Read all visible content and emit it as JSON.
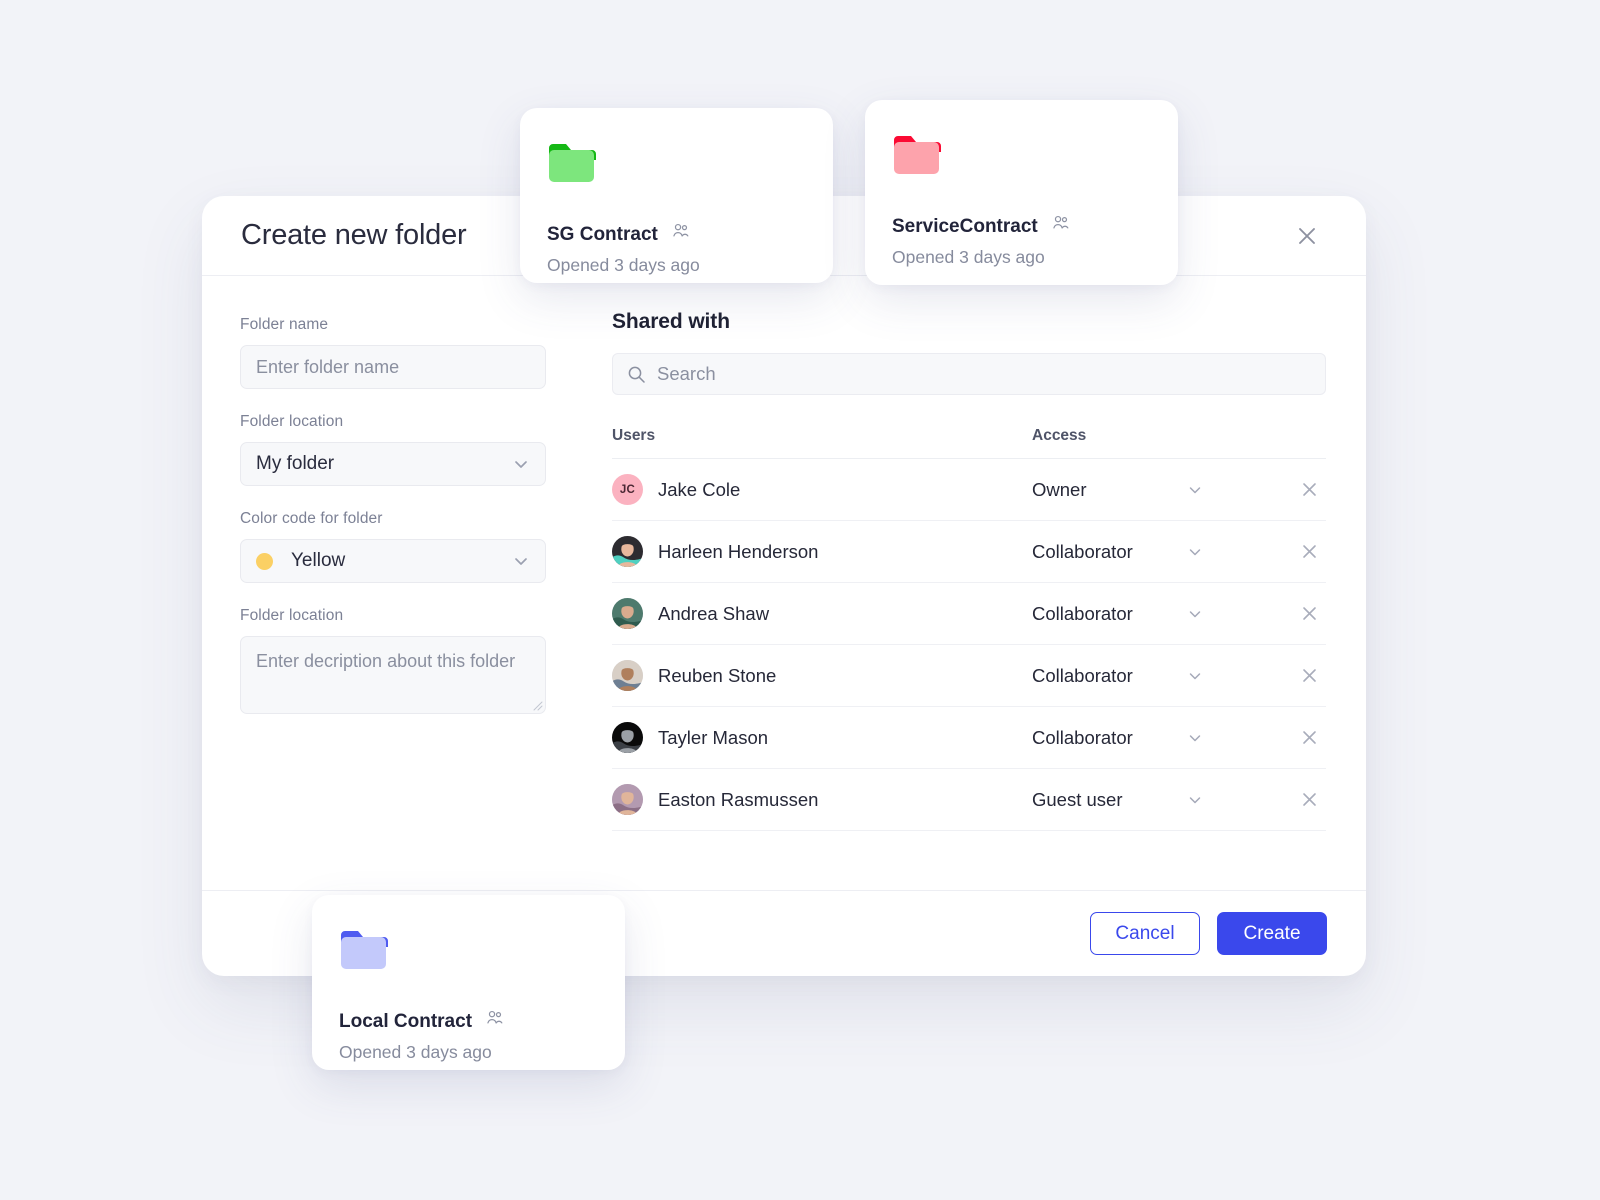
{
  "theme": {
    "background": "#f2f3f8",
    "accent": "#3a48ec",
    "surface": "#ffffff",
    "muted_text": "#7c8195",
    "body_text": "#262838"
  },
  "modal": {
    "title": "Create new folder",
    "close_icon": "close-icon",
    "form": {
      "name_field": {
        "label": "Folder name",
        "placeholder": "Enter folder name",
        "value": ""
      },
      "location_field": {
        "label": "Folder location",
        "value": "My folder",
        "chevron_icon": "chevron-down-icon"
      },
      "color_field": {
        "label": "Color code for folder",
        "value": "Yellow",
        "swatch": "#fbd064",
        "chevron_icon": "chevron-down-icon"
      },
      "description_field": {
        "label": "Folder location",
        "placeholder": "Enter decription about this folder",
        "value": ""
      }
    },
    "shared": {
      "title": "Shared with",
      "search": {
        "placeholder": "Search",
        "value": "",
        "icon": "search-icon"
      },
      "columns": {
        "users": "Users",
        "access": "Access"
      },
      "rows": [
        {
          "name": "Jake Cole",
          "access": "Owner",
          "avatar_type": "initials",
          "initials": "JC",
          "avatar_bg": "#fbb2c0",
          "avatar_fg": "#4a2733",
          "chevron_icon": "chevron-down-icon",
          "remove_icon": "close-icon"
        },
        {
          "name": "Harleen Henderson",
          "access": "Collaborator",
          "avatar_type": "photo",
          "avatar_bg": "#2d2b30",
          "avatar_fg": "#e8b79c",
          "avatar_accent": "#4fd0c0",
          "chevron_icon": "chevron-down-icon",
          "remove_icon": "close-icon"
        },
        {
          "name": "Andrea Shaw",
          "access": "Collaborator",
          "avatar_type": "photo",
          "avatar_bg": "#4e7a6d",
          "avatar_fg": "#d9ab8e",
          "avatar_accent": "#2f5b4e",
          "chevron_icon": "chevron-down-icon",
          "remove_icon": "close-icon"
        },
        {
          "name": "Reuben Stone",
          "access": "Collaborator",
          "avatar_type": "photo",
          "avatar_bg": "#d8cfc6",
          "avatar_fg": "#b07f5c",
          "avatar_accent": "#6e7f93",
          "chevron_icon": "chevron-down-icon",
          "remove_icon": "close-icon"
        },
        {
          "name": "Tayler Mason",
          "access": "Collaborator",
          "avatar_type": "photo",
          "avatar_bg": "#0a0a0a",
          "avatar_fg": "#9ba0a6",
          "avatar_accent": "#3b3f45",
          "chevron_icon": "chevron-down-icon",
          "remove_icon": "close-icon"
        },
        {
          "name": "Easton Rasmussen",
          "access": "Guest user",
          "avatar_type": "photo",
          "avatar_bg": "#b39ab0",
          "avatar_fg": "#e0b59a",
          "avatar_accent": "#8c6f86",
          "chevron_icon": "chevron-down-icon",
          "remove_icon": "close-icon"
        }
      ]
    },
    "footer": {
      "cancel_label": "Cancel",
      "create_label": "Create"
    }
  },
  "folder_cards": [
    {
      "name": "SG Contract",
      "subtitle": "Opened 3 days ago",
      "folder_icon": "folder-icon",
      "shared_icon": "users-icon",
      "tab_color": "#15b815",
      "body_color": "#7de67d"
    },
    {
      "name": "ServiceContract",
      "subtitle": "Opened 3 days ago",
      "folder_icon": "folder-icon",
      "shared_icon": "users-icon",
      "tab_color": "#fb0a33",
      "body_color": "#fda3ac"
    },
    {
      "name": "Local Contract",
      "subtitle": "Opened 3 days ago",
      "folder_icon": "folder-icon",
      "shared_icon": "users-icon",
      "tab_color": "#4f5bf0",
      "body_color": "#c3c9fb"
    }
  ]
}
